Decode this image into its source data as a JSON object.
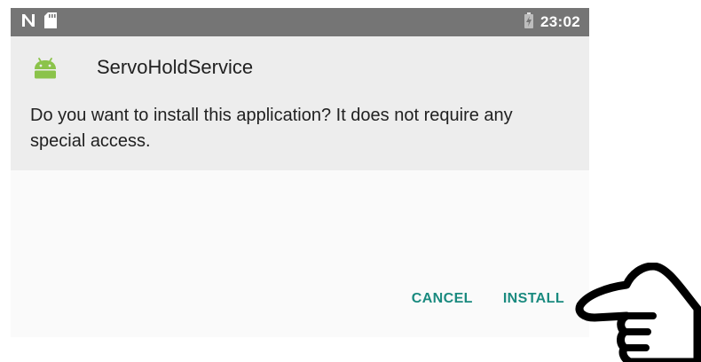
{
  "status_bar": {
    "time": "23:02",
    "left_icons": [
      "n-notification-icon",
      "sd-card-icon"
    ],
    "right_icons": [
      "battery-charging-icon"
    ],
    "background": "#757575"
  },
  "dialog": {
    "app_name": "ServoHoldService",
    "app_icon": "android-icon",
    "message": "Do you want to install this application? It does not require any special access.",
    "buttons": {
      "cancel_label": "CANCEL",
      "install_label": "INSTALL"
    },
    "accent_color": "#1a8a7f"
  },
  "overlay": {
    "pointer_icon": "hand-pointer-icon"
  }
}
